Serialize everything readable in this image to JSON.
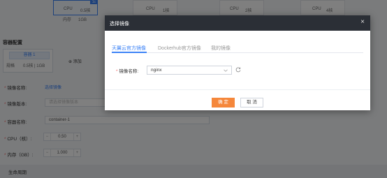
{
  "background": {
    "spec_cards": [
      {
        "cpu_label": "CPU",
        "cpu_value": "0.5核",
        "mem_label": "内存",
        "mem_value": "1GB",
        "tag": "1c",
        "selected": true
      },
      {
        "cpu_label": "CPU",
        "cpu_value": "1核",
        "selected": false
      },
      {
        "cpu_label": "CPU",
        "cpu_value": "2核",
        "selected": false
      },
      {
        "cpu_label": "CPU",
        "cpu_value": "4核",
        "selected": false
      }
    ],
    "section_title": "容器配置",
    "container_tab": {
      "label": "容器 1",
      "spec": "规格　　0.5核 | 1GB"
    },
    "add_label": "添加",
    "form": {
      "image_name_label": "镜像名称:",
      "image_name_link": "选择镜像",
      "image_version_label": "镜像版本:",
      "image_version_placeholder": "请选择镜像版本",
      "container_name_label": "容器名称:",
      "container_name_value": "container-1",
      "cpu_label": "CPU（核）:",
      "cpu_value": "0.50",
      "mem_label": "内存（GB）:",
      "mem_value": "1.000"
    },
    "lifecycle_label": "生命周期"
  },
  "dialog": {
    "title": "选择镜像",
    "tabs": [
      {
        "label": "天翼云官方镜像",
        "active": true
      },
      {
        "label": "Dockerhub官方镜像",
        "active": false
      },
      {
        "label": "我的镜像",
        "active": false
      }
    ],
    "image_name_label": "镜像名称:",
    "image_name_value": "nginx",
    "ok_label": "确 定",
    "cancel_label": "取 消"
  },
  "colors": {
    "accent": "#3b82f6",
    "primary_button": "#f5873b",
    "header": "#2b2f36",
    "required": "#f56c6c"
  }
}
